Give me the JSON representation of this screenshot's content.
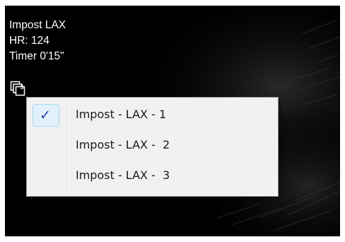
{
  "overlay": {
    "series_name": "Impost LAX",
    "heart_rate": "HR: 124",
    "timer": "Timer 0'15\""
  },
  "series_button": {
    "icon": "stacked-frames-icon",
    "count": "3"
  },
  "menu": {
    "items": [
      {
        "label": "Impost - LAX - 1",
        "checked": true
      },
      {
        "label": "Impost - LAX -  2",
        "checked": false
      },
      {
        "label": "Impost - LAX -  3",
        "checked": false
      }
    ],
    "check_glyph": "✓",
    "colors": {
      "background": "#f1f1f1",
      "border": "#979797",
      "check_highlight": "#e1f0fa",
      "check_color": "#1c3fa8"
    }
  },
  "viewer": {
    "background": "#000000",
    "text_color": "#ffffff"
  }
}
